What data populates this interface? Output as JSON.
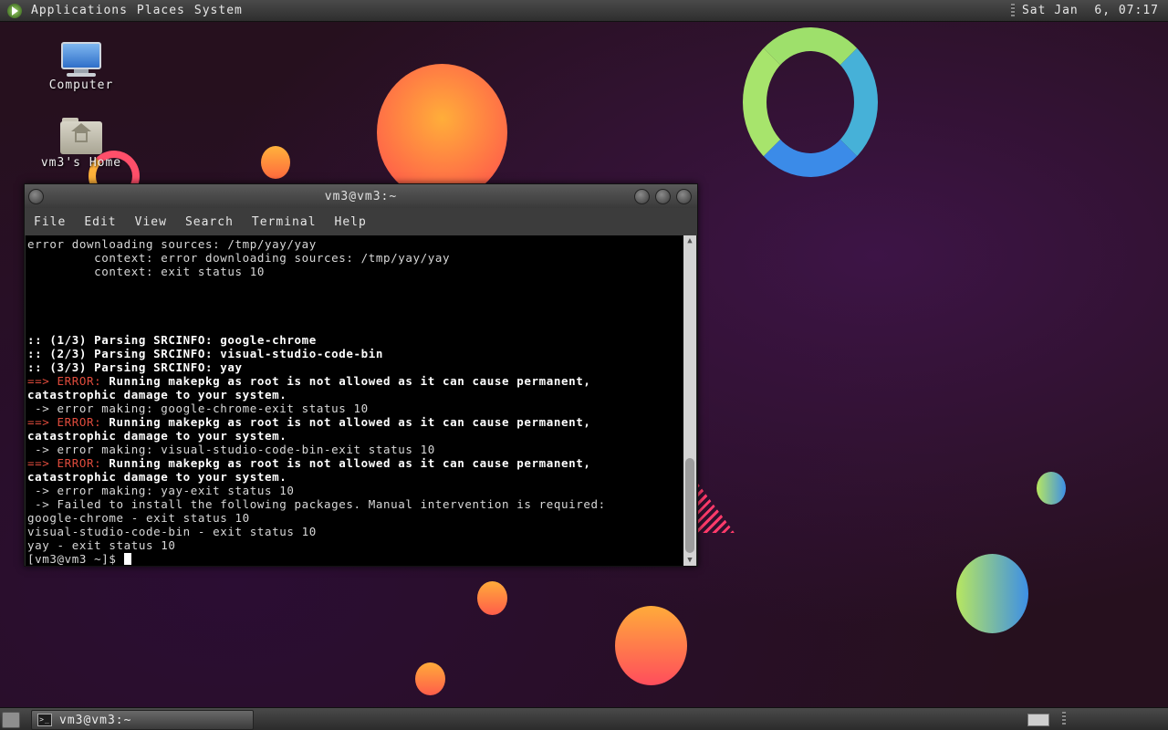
{
  "top_panel": {
    "menus": [
      "Applications",
      "Places",
      "System"
    ],
    "clock": "Sat Jan  6, 07:17"
  },
  "desktop": {
    "icons": [
      {
        "label": "Computer",
        "icon": "computer-icon"
      },
      {
        "label": "vm3's Home",
        "icon": "home-folder-icon"
      }
    ]
  },
  "terminal": {
    "title": "vm3@vm3:~",
    "menu": [
      "File",
      "Edit",
      "View",
      "Search",
      "Terminal",
      "Help"
    ],
    "lines": [
      "error downloading sources: /tmp/yay/yay",
      "         context: error downloading sources: /tmp/yay/yay",
      "         context: exit status 10",
      "",
      "",
      "",
      "",
      ":: (1/3) Parsing SRCINFO: google-chrome",
      ":: (2/3) Parsing SRCINFO: visual-studio-code-bin",
      ":: (3/3) Parsing SRCINFO: yay",
      "==> ERROR: Running makepkg as root is not allowed as it can cause permanent,",
      "catastrophic damage to your system.",
      " -> error making: google-chrome-exit status 10",
      "==> ERROR: Running makepkg as root is not allowed as it can cause permanent,",
      "catastrophic damage to your system.",
      " -> error making: visual-studio-code-bin-exit status 10",
      "==> ERROR: Running makepkg as root is not allowed as it can cause permanent,",
      "catastrophic damage to your system.",
      " -> error making: yay-exit status 10",
      " -> Failed to install the following packages. Manual intervention is required:",
      "google-chrome - exit status 10",
      "visual-studio-code-bin - exit status 10",
      "yay - exit status 10",
      "[vm3@vm3 ~]$ "
    ]
  },
  "taskbar": {
    "task_label": "vm3@vm3:~"
  },
  "colors": {
    "error": "#e04b3c",
    "background": "#26101e"
  }
}
